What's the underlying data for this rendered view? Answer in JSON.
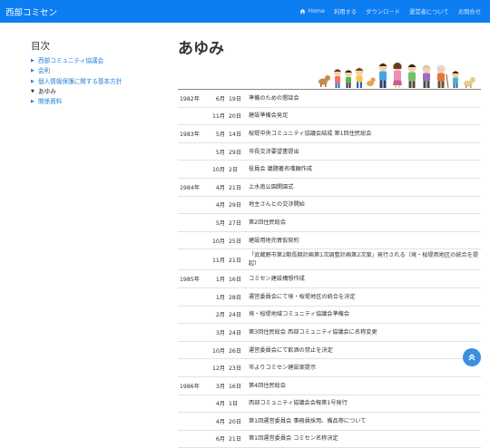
{
  "navbar": {
    "brand": "西部コミセン",
    "links": [
      "Home",
      "利用する",
      "ダウンロード",
      "運営者について",
      "お問合せ"
    ]
  },
  "sidebar": {
    "title": "目次",
    "items": [
      {
        "label": "西部コミュニティ協議会"
      },
      {
        "label": "会則"
      },
      {
        "label": "個人情報保護に関する基本方針"
      },
      {
        "label": "あゆみ"
      },
      {
        "label": "関係資料"
      }
    ]
  },
  "main": {
    "title": "あゆみ",
    "rows": [
      {
        "year": "1982年",
        "month": "6月",
        "day": "19日",
        "event": "準備のための懇談会"
      },
      {
        "year": "",
        "month": "11月",
        "day": "20日",
        "event": "建設準備会発足"
      },
      {
        "year": "1983年",
        "month": "5月",
        "day": "14日",
        "event": "桜堤中央コミュニティ協議会結成 第1回住民総会"
      },
      {
        "year": "",
        "month": "5月",
        "day": "29日",
        "event": "市長交渉要望書提出"
      },
      {
        "year": "",
        "month": "10月",
        "day": "2日",
        "event": "役員会 議題著名嘆願作成"
      },
      {
        "year": "1984年",
        "month": "4月",
        "day": "21日",
        "event": "上水南公園開園式"
      },
      {
        "year": "",
        "month": "4月",
        "day": "29日",
        "event": "地主さんとの交渉開始"
      },
      {
        "year": "",
        "month": "5月",
        "day": "27日",
        "event": "第2回住民総会"
      },
      {
        "year": "",
        "month": "10月",
        "day": "25日",
        "event": "建設用地売買仮契約"
      },
      {
        "year": "",
        "month": "11月",
        "day": "21日",
        "event": "「武蔵野市第2期長期計画第1次調整計画第2次案」発行される（境・桜堤両地区の統合を提起）"
      },
      {
        "year": "1985年",
        "month": "1月",
        "day": "16日",
        "event": "コミセン建設構想作成"
      },
      {
        "year": "",
        "month": "1月",
        "day": "28日",
        "event": "運営委員会にて境・桜堤地区の統合を決定"
      },
      {
        "year": "",
        "month": "2月",
        "day": "24日",
        "event": "境・桜堤地域コミュニティ協議会準備会"
      },
      {
        "year": "",
        "month": "3月",
        "day": "24日",
        "event": "第3回住民総会 西部コミュニティ協議会に名称変更"
      },
      {
        "year": "",
        "month": "10月",
        "day": "26日",
        "event": "運営委員会にて飲酒の禁止を決定"
      },
      {
        "year": "",
        "month": "12月",
        "day": "23日",
        "event": "市よりコミセン建設案提示"
      },
      {
        "year": "1986年",
        "month": "3月",
        "day": "16日",
        "event": "第4回住民総会"
      },
      {
        "year": "",
        "month": "4月",
        "day": "1日",
        "event": "西部コミュニティ協議会会報第1号発行"
      },
      {
        "year": "",
        "month": "4月",
        "day": "20日",
        "event": "第1回運営委員会 事務員採用、備品等について"
      },
      {
        "year": "",
        "month": "6月",
        "day": "21日",
        "event": "第1回運営委員会 コミセン名称決定"
      }
    ]
  },
  "colors": {
    "navbar": "#0d7df2",
    "link": "#1f7ed8",
    "fab": "#3a8fe0"
  },
  "icons": {
    "home": "home-icon",
    "scroll_top": "chevron-double-up-icon",
    "toc_marker": "triangle-right-icon",
    "illustration": "family-illustration"
  }
}
